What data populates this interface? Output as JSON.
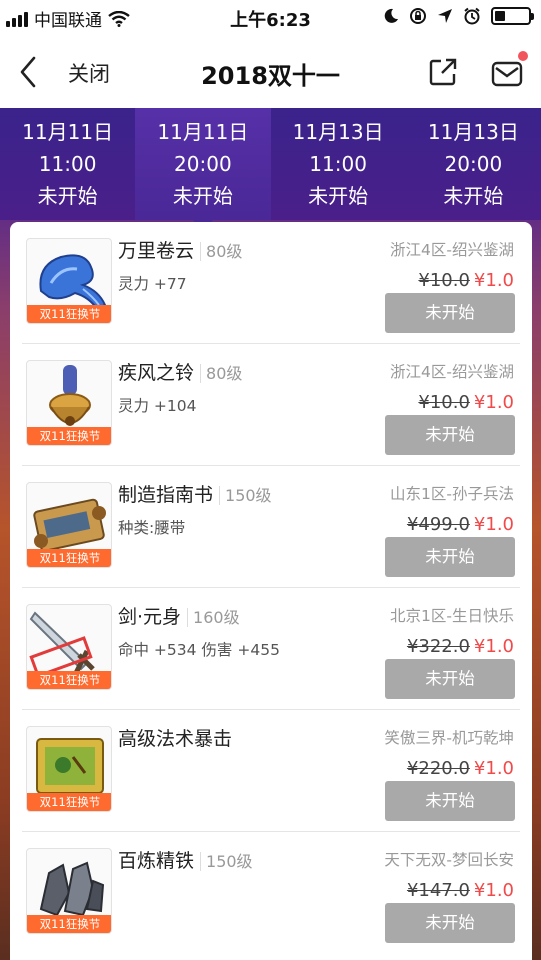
{
  "status": {
    "carrier": "中国联通",
    "time": "上午6:23"
  },
  "nav": {
    "close_label": "关闭",
    "title": "2018双十一"
  },
  "tabs": [
    {
      "date": "11月11日",
      "time": "11:00",
      "state": "未开始"
    },
    {
      "date": "11月11日",
      "time": "20:00",
      "state": "未开始"
    },
    {
      "date": "11月13日",
      "time": "11:00",
      "state": "未开始"
    },
    {
      "date": "11月13日",
      "time": "20:00",
      "state": "未开始"
    }
  ],
  "items": [
    {
      "name": "万里卷云",
      "level": "80级",
      "attr": "灵力 +77",
      "server": "浙江4区-绍兴鉴湖",
      "old_price": "¥10.0",
      "new_price": "¥1.0",
      "badge": "双11狂换节",
      "button": "未开始",
      "icon": "ribbon-icon"
    },
    {
      "name": "疾风之铃",
      "level": "80级",
      "attr": "灵力 +104",
      "server": "浙江4区-绍兴鉴湖",
      "old_price": "¥10.0",
      "new_price": "¥1.0",
      "badge": "双11狂换节",
      "button": "未开始",
      "icon": "bell-icon"
    },
    {
      "name": "制造指南书",
      "level": "150级",
      "attr": "种类:腰带",
      "server": "山东1区-孙子兵法",
      "old_price": "¥499.0",
      "new_price": "¥1.0",
      "badge": "双11狂换节",
      "button": "未开始",
      "icon": "scroll-icon"
    },
    {
      "name": "剑·元身",
      "level": "160级",
      "attr": "命中 +534 伤害 +455",
      "server": "北京1区-生日快乐",
      "old_price": "¥322.0",
      "new_price": "¥1.0",
      "badge": "双11狂换节",
      "button": "未开始",
      "icon": "sword-icon"
    },
    {
      "name": "高级法术暴击",
      "level": "",
      "attr": "",
      "server": "笑傲三界-机巧乾坤",
      "old_price": "¥220.0",
      "new_price": "¥1.0",
      "badge": "双11狂换节",
      "button": "未开始",
      "icon": "skill-book-icon"
    },
    {
      "name": "百炼精铁",
      "level": "150级",
      "attr": "",
      "server": "天下无双-梦回长安",
      "old_price": "¥147.0",
      "new_price": "¥1.0",
      "badge": "双11狂换节",
      "button": "未开始",
      "icon": "iron-ore-icon"
    }
  ]
}
